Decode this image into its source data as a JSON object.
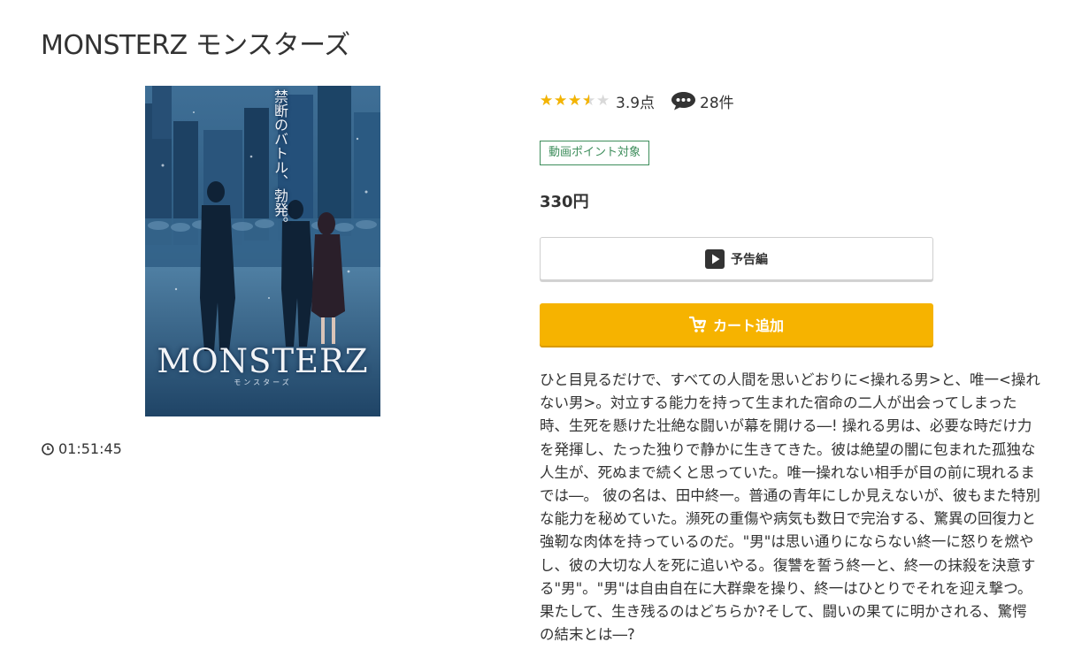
{
  "page": {
    "title": "MONSTERZ モンスターズ"
  },
  "poster": {
    "title_text": "MONSTERZ",
    "subtitle_text": "モンスターズ",
    "tagline_text": "禁断のバトル、勃発。"
  },
  "duration": {
    "value": "01:51:45",
    "icon": "clock-icon"
  },
  "rating": {
    "value": 3.9,
    "max": 5,
    "score_label": "3.9点",
    "comments_count": "28件",
    "comment_icon": "speech-bubble-icon",
    "star_color": "#f4b400",
    "star_empty_color": "#d9d9d9"
  },
  "badge": {
    "label": "動画ポイント対象",
    "color": "#3d8d5b"
  },
  "price": {
    "label": "330円"
  },
  "buttons": {
    "trailer_label": "予告編",
    "trailer_icon": "play-icon",
    "cart_label": "カート追加",
    "cart_icon": "cart-icon",
    "cart_color": "#f6b300"
  },
  "description": {
    "text": "ひと目見るだけで、すべての人間を思いどおりに<操れる男>と、唯一<操れない男>。対立する能力を持って生まれた宿命の二人が出会ってしまった時、生死を懸けた壮絶な闘いが幕を開ける―! 操れる男は、必要な時だけ力を発揮し、たった独りで静かに生きてきた。彼は絶望の闇に包まれた孤独な人生が、死ぬまで続くと思っていた。唯一操れない相手が目の前に現れるまでは―。 彼の名は、田中終一。普通の青年にしか見えないが、彼もまた特別な能力を秘めていた。瀕死の重傷や病気も数日で完治する、驚異の回復力と強靭な肉体を持っているのだ。\"男\"は思い通りにならない終一に怒りを燃やし、彼の大切な人を死に追いやる。復讐を誓う終一と、終一の抹殺を決意する\"男\"。\"男\"は自由自在に大群衆を操り、終一はひとりでそれを迎え撃つ。果たして、生き残るのはどちらか?そして、闘いの果てに明かされる、驚愕の結末とは―?"
  }
}
